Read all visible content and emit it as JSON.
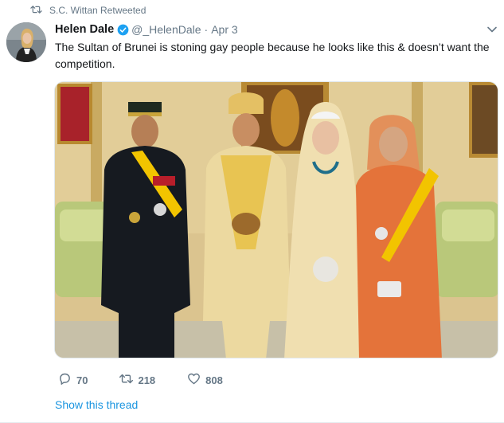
{
  "retweet": {
    "icon": "retweet-icon",
    "text": "S.C. Wittan Retweeted"
  },
  "author": {
    "name": "Helen Dale",
    "verified": true,
    "handle": "@_HelenDale",
    "separator": "·",
    "date": "Apr 3"
  },
  "tweet": {
    "text": "The Sultan of Brunei is stoning gay people because he looks like this & doesn’t want the competition."
  },
  "actions": {
    "replies": "70",
    "retweets": "218",
    "likes": "808"
  },
  "thread_link": "Show this thread",
  "colors": {
    "link": "#1b95e0",
    "secondary": "#657786",
    "verified": "#1da1f2"
  }
}
